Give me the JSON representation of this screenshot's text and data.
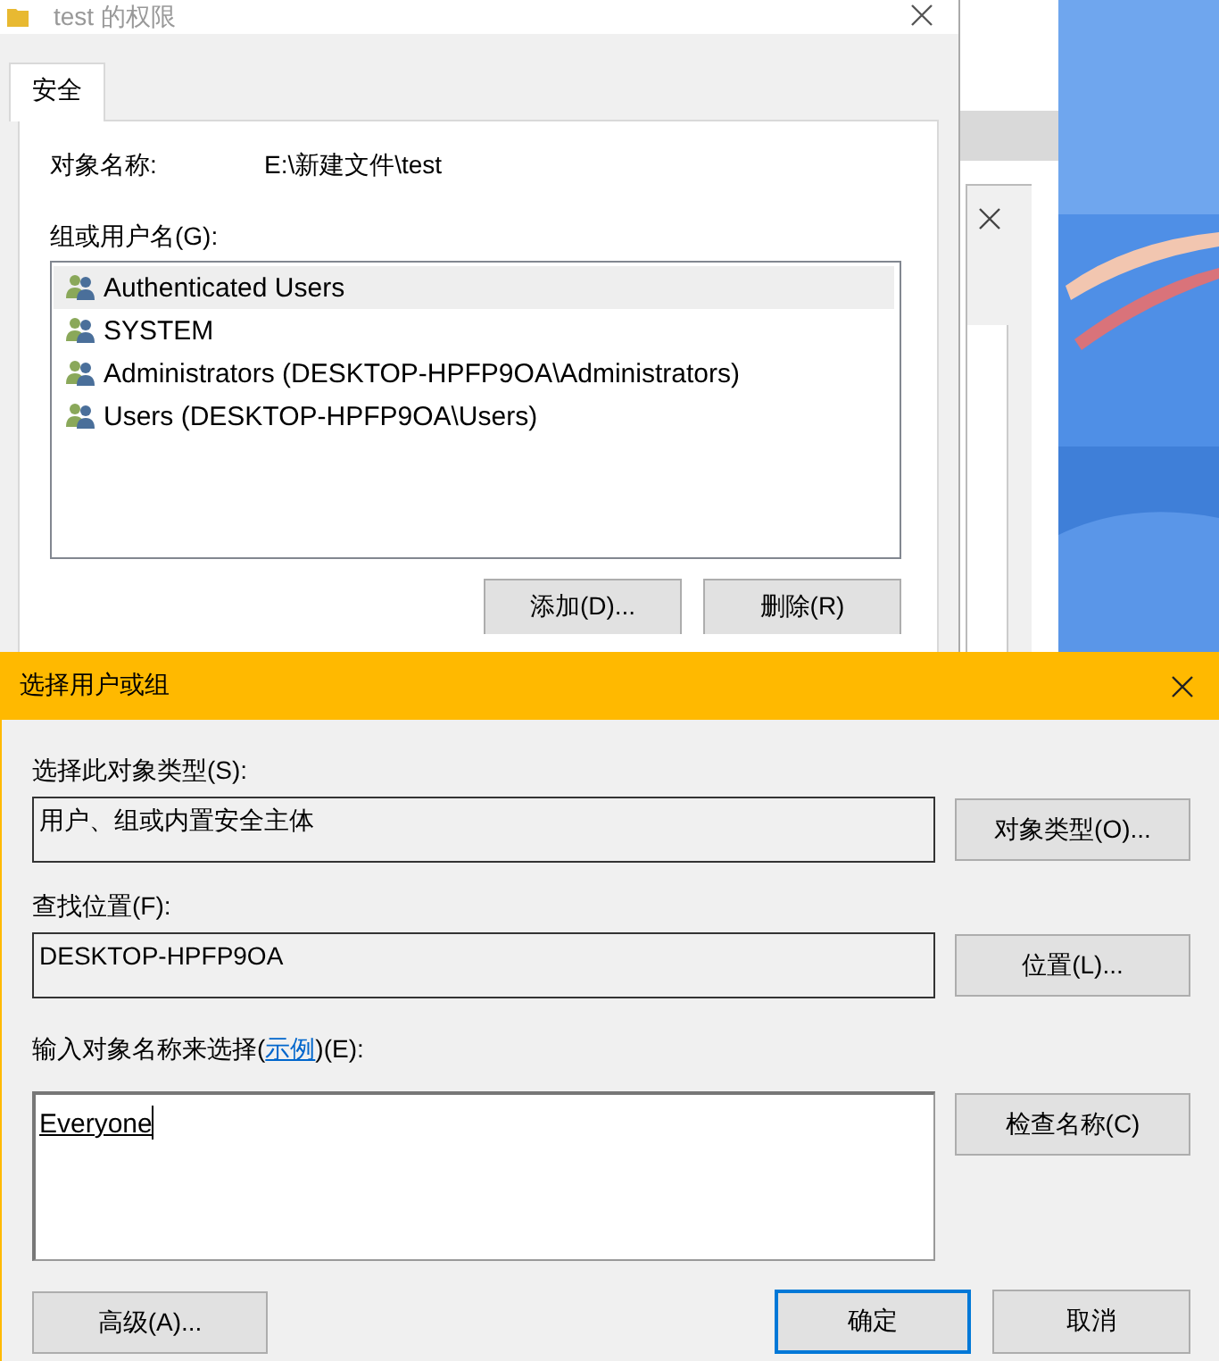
{
  "permissions_window": {
    "title": "test 的权限",
    "tabs": [
      {
        "label": "安全",
        "selected": true
      }
    ],
    "object_name_label": "对象名称:",
    "object_name": "E:\\新建文件\\test",
    "group_label": "组或用户名(G):",
    "users": [
      {
        "name": "Authenticated Users",
        "selected": true
      },
      {
        "name": "SYSTEM",
        "selected": false
      },
      {
        "name": "Administrators (DESKTOP-HPFP9OA\\Administrators)",
        "selected": false
      },
      {
        "name": "Users (DESKTOP-HPFP9OA\\Users)",
        "selected": false
      }
    ],
    "buttons": [
      "添加(D)...",
      "删除(R)"
    ]
  },
  "select_dialog": {
    "title": "选择用户或组",
    "object_type_label": "选择此对象类型(S):",
    "object_type": "用户、组或内置安全主体",
    "object_type_button": "对象类型(O)...",
    "location_label": "查找位置(F):",
    "location": "DESKTOP-HPFP9OA",
    "location_button": "位置(L)...",
    "names_label_before": "输入对象名称来选择(",
    "names_label_link": "示例",
    "names_label_after": ")(E):",
    "names_value": "Everyone",
    "check_button": "检查名称(C)",
    "advanced_button": "高级(A)...",
    "ok_button": "确定",
    "cancel_button": "取消"
  }
}
